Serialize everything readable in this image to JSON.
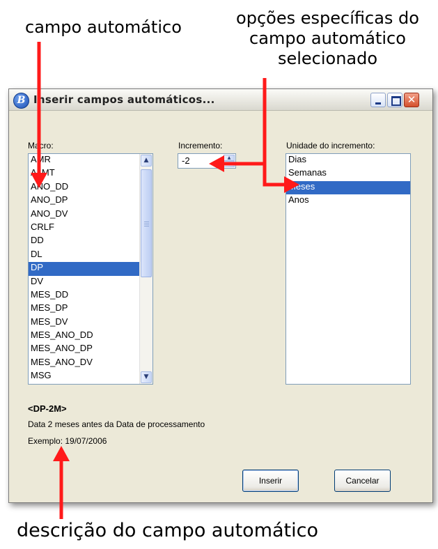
{
  "annotations": {
    "top_left": "campo automático",
    "top_right": "opções específicas do campo automático selecionado",
    "bottom": "descrição do campo automático"
  },
  "colors": {
    "arrow": "#ff1a1a",
    "selection": "#316ac5"
  },
  "window": {
    "icon_letter": "B",
    "title": "Inserir campos automáticos...",
    "controls": {
      "minimize": "minimize-icon",
      "maximize": "maximize-icon",
      "close": "close-icon"
    }
  },
  "macro": {
    "label": "Macro:",
    "items": [
      "AMR",
      "A_MT",
      "ANO_DD",
      "ANO_DP",
      "ANO_DV",
      "CRLF",
      "DD",
      "DL",
      "DP",
      "DV",
      "MES_DD",
      "MES_DP",
      "MES_DV",
      "MES_ANO_DD",
      "MES_ANO_DP",
      "MES_ANO_DV",
      "MSG"
    ],
    "selected": "DP"
  },
  "incremento": {
    "label": "Incremento:",
    "value": "-2"
  },
  "unidade": {
    "label": "Unidade do incremento:",
    "items": [
      "Dias",
      "Semanas",
      "Meses",
      "Anos"
    ],
    "selected": "Meses"
  },
  "description": {
    "title": "<DP-2M>",
    "text": "Data 2 meses antes da Data de processamento",
    "example": "Exemplo: 19/07/2006"
  },
  "buttons": {
    "insert": "Inserir",
    "cancel": "Cancelar"
  }
}
